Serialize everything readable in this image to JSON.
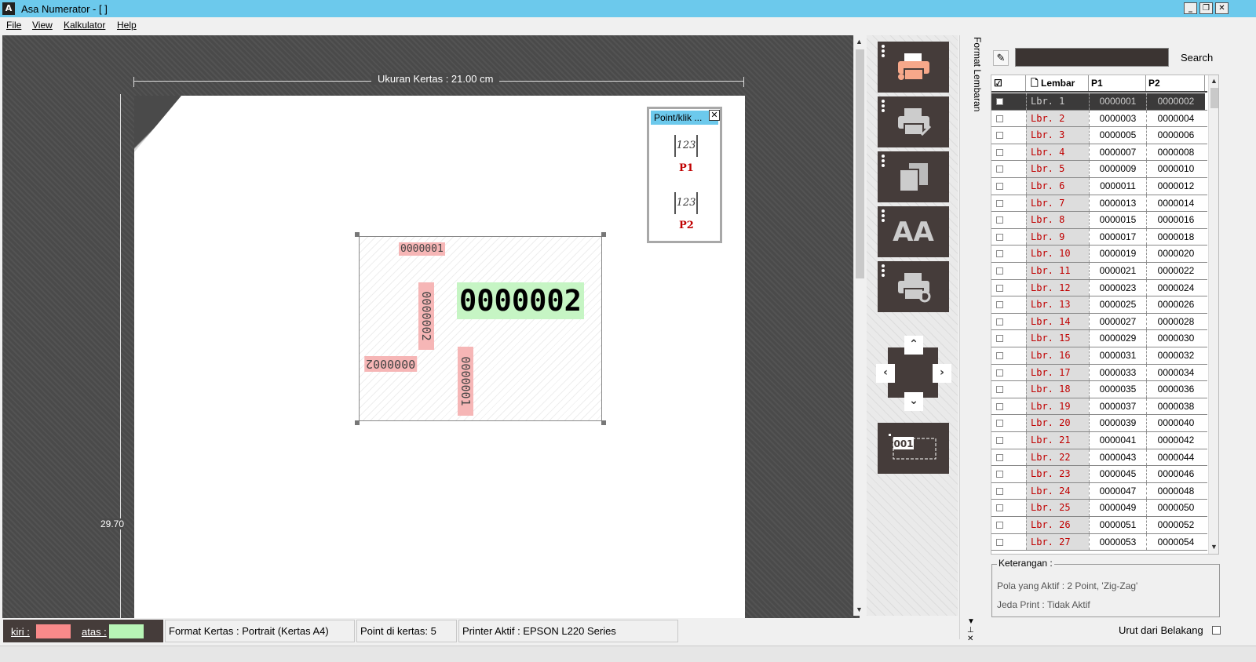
{
  "window": {
    "title": "Asa Numerator   - [ ]",
    "icon": "app-icon",
    "minimize": "_",
    "restore": "❐",
    "close": "✕"
  },
  "menu": [
    "File",
    "View",
    "Kalkulator",
    "Help"
  ],
  "canvas": {
    "ruler_width_label": "Ukuran Kertas : 21.00 cm",
    "ruler_height_label": "29.70",
    "points": {
      "small_h": "0000001",
      "big": "0000002",
      "vert1": "0000002",
      "rot180": "0000002",
      "vert2": "0000001"
    }
  },
  "popup": {
    "title": "Point/klik ...",
    "close": "✕",
    "items": [
      {
        "icon": "123",
        "label": "P1"
      },
      {
        "icon": "123",
        "label": "P2"
      }
    ]
  },
  "toolbar": {
    "buttons": [
      "print-icon",
      "print-check-icon",
      "copy-pages-icon",
      "font-icon",
      "printer-settings-icon",
      "move-icon",
      "numbering-label-icon"
    ],
    "font_glyph": "AA",
    "numbering_glyph": "001"
  },
  "side_tab": {
    "label": "Format Lembaran"
  },
  "search": {
    "value": "",
    "button_label": "Search"
  },
  "table": {
    "headers": [
      "Lembar",
      "P1",
      "P2"
    ],
    "rows": [
      [
        "Lbr.  1",
        "0000001",
        "0000002"
      ],
      [
        "Lbr.  2",
        "0000003",
        "0000004"
      ],
      [
        "Lbr.  3",
        "0000005",
        "0000006"
      ],
      [
        "Lbr.  4",
        "0000007",
        "0000008"
      ],
      [
        "Lbr.  5",
        "0000009",
        "0000010"
      ],
      [
        "Lbr.  6",
        "0000011",
        "0000012"
      ],
      [
        "Lbr.  7",
        "0000013",
        "0000014"
      ],
      [
        "Lbr.  8",
        "0000015",
        "0000016"
      ],
      [
        "Lbr.  9",
        "0000017",
        "0000018"
      ],
      [
        "Lbr.  10",
        "0000019",
        "0000020"
      ],
      [
        "Lbr.  11",
        "0000021",
        "0000022"
      ],
      [
        "Lbr.  12",
        "0000023",
        "0000024"
      ],
      [
        "Lbr.  13",
        "0000025",
        "0000026"
      ],
      [
        "Lbr.  14",
        "0000027",
        "0000028"
      ],
      [
        "Lbr.  15",
        "0000029",
        "0000030"
      ],
      [
        "Lbr.  16",
        "0000031",
        "0000032"
      ],
      [
        "Lbr.  17",
        "0000033",
        "0000034"
      ],
      [
        "Lbr.  18",
        "0000035",
        "0000036"
      ],
      [
        "Lbr.  19",
        "0000037",
        "0000038"
      ],
      [
        "Lbr.  20",
        "0000039",
        "0000040"
      ],
      [
        "Lbr.  21",
        "0000041",
        "0000042"
      ],
      [
        "Lbr.  22",
        "0000043",
        "0000044"
      ],
      [
        "Lbr.  23",
        "0000045",
        "0000046"
      ],
      [
        "Lbr.  24",
        "0000047",
        "0000048"
      ],
      [
        "Lbr.  25",
        "0000049",
        "0000050"
      ],
      [
        "Lbr.  26",
        "0000051",
        "0000052"
      ],
      [
        "Lbr.  27",
        "0000053",
        "0000054"
      ]
    ]
  },
  "keterangan": {
    "title": "Keterangan :",
    "pola": "Pola yang Aktif :  2 Point, 'Zig-Zag'",
    "jeda": "Jeda Print :  Tidak Aktif"
  },
  "urut": {
    "label": "Urut dari Belakang"
  },
  "status": {
    "kiri_label": "kiri :",
    "atas_label": "atas :",
    "kiri_color": "#f98a8a",
    "atas_color": "#b8f5b6",
    "format": "Format Kertas : Portrait (Kertas A4)",
    "points": "Point di kertas: 5",
    "printer": "Printer Aktif : EPSON L220 Series"
  },
  "colors": {
    "titlebar": "#6cc9ec",
    "dark_panel": "#453c3a",
    "row_label": "#c00000"
  }
}
